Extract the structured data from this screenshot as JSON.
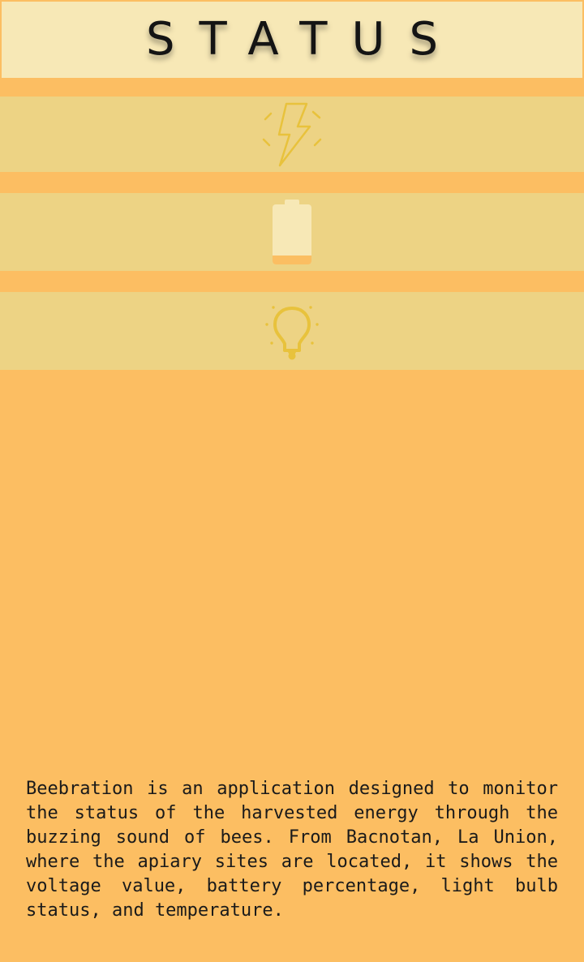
{
  "header": {
    "title": "STATUS"
  },
  "status_items": [
    {
      "name": "voltage",
      "icon": "lightning-bolt-icon"
    },
    {
      "name": "battery",
      "icon": "battery-icon"
    },
    {
      "name": "light_bulb",
      "icon": "light-bulb-icon"
    }
  ],
  "description": {
    "text": "Beebration is an application designed to monitor the status of the harvested energy through the buzzing sound of bees. From Bacnotan, La Union, where the apiary sites are located, it shows the voltage value, battery percentage, light bulb status, and temperature."
  },
  "colors": {
    "background": "#fcbe62",
    "header_background": "#f7e8b6",
    "row_background": "#edd384",
    "icon_color": "#e8c23c",
    "battery_fill": "#f7e8b6",
    "battery_level": "#fbbe62",
    "text": "#1a1a1a"
  }
}
